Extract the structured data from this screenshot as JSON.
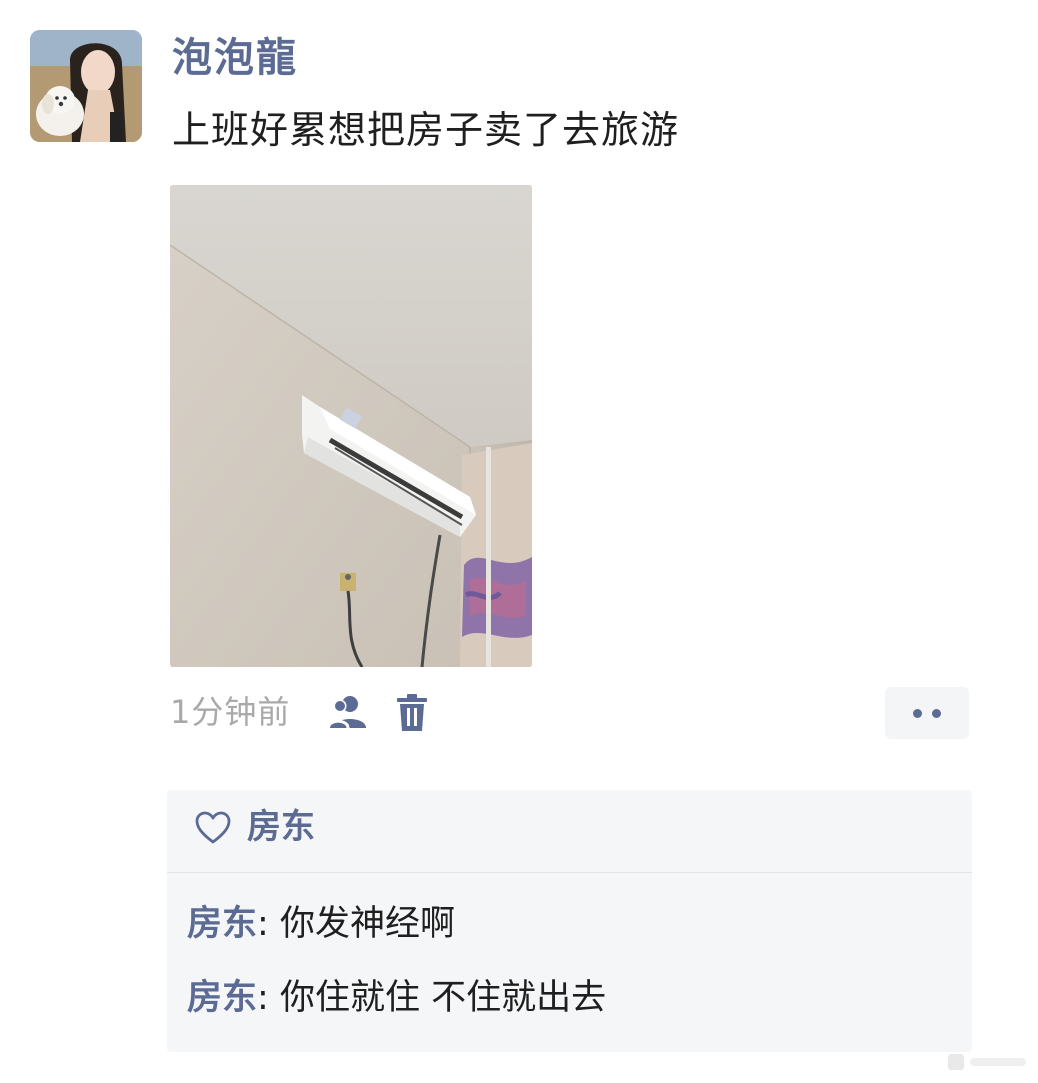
{
  "post": {
    "username": "泡泡龍",
    "text": "上班好累想把房子卖了去旅游",
    "timestamp": "1分钟前"
  },
  "icons": {
    "avatar": "avatar-image",
    "photo": "air-conditioner-photo",
    "friends": "friends-icon",
    "delete": "trash-icon",
    "more": "more-dots-icon",
    "like": "heart-outline-icon"
  },
  "likes": {
    "names": "房东"
  },
  "comments": [
    {
      "author": "房东",
      "separator": ": ",
      "text": "你发神经啊"
    },
    {
      "author": "房东",
      "separator": ": ",
      "text": "你住就住 不住就出去"
    }
  ],
  "colors": {
    "name_link": "#5b6b93",
    "text": "#1f1f1f",
    "timestamp": "#a9a9a9",
    "box_bg": "#f5f6f8"
  }
}
